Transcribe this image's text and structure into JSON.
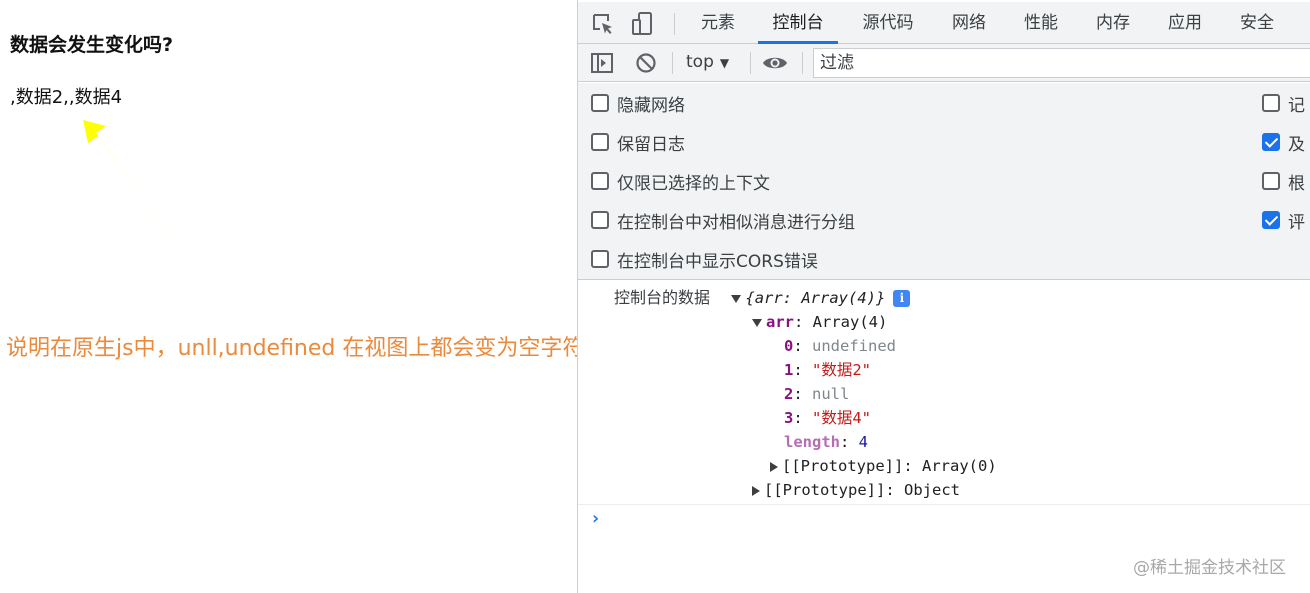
{
  "page": {
    "title": "数据会发生变化吗?",
    "rendered_text": ",数据2,,数据4",
    "annotation": "说明在原生js中，unll,undefined 在视图上都会变为空字符串",
    "annotation_color": "#ea8a3c",
    "arrow_color": "#ffff00"
  },
  "devtools": {
    "tool_icons": [
      "inspect-element-icon",
      "device-toolbar-icon"
    ],
    "tabs": [
      {
        "label": "元素",
        "active": false
      },
      {
        "label": "控制台",
        "active": true
      },
      {
        "label": "源代码",
        "active": false
      },
      {
        "label": "网络",
        "active": false
      },
      {
        "label": "性能",
        "active": false
      },
      {
        "label": "内存",
        "active": false
      },
      {
        "label": "应用",
        "active": false
      },
      {
        "label": "安全",
        "active": false
      }
    ],
    "accent_color": "#1a73e8",
    "toolbar": {
      "context": "top",
      "filter_placeholder": "过滤"
    },
    "settings_left": [
      {
        "label": "隐藏网络",
        "checked": false
      },
      {
        "label": "保留日志",
        "checked": false
      },
      {
        "label": "仅限已选择的上下文",
        "checked": false
      },
      {
        "label": "在控制台中对相似消息进行分组",
        "checked": false
      },
      {
        "label": "在控制台中显示CORS错误",
        "checked": false
      }
    ],
    "settings_right": [
      {
        "label": "记",
        "checked": false
      },
      {
        "label": "及",
        "checked": true
      },
      {
        "label": "根",
        "checked": false
      },
      {
        "label": "评",
        "checked": true
      }
    ],
    "console": {
      "label": "控制台的数据",
      "summary": "{arr: Array(4)}",
      "info_badge": "i",
      "arr_key": "arr",
      "arr_value": "Array(4)",
      "items": [
        {
          "key": "0",
          "value": "undefined",
          "kind": "gray"
        },
        {
          "key": "1",
          "value": "\"数据2\"",
          "kind": "str"
        },
        {
          "key": "2",
          "value": "null",
          "kind": "gray"
        },
        {
          "key": "3",
          "value": "\"数据4\"",
          "kind": "str"
        }
      ],
      "length_key": "length",
      "length_value": "4",
      "arr_proto_key": "[[Prototype]]",
      "arr_proto_value": "Array(0)",
      "obj_proto_key": "[[Prototype]]",
      "obj_proto_value": "Object",
      "prompt": "›"
    },
    "watermark": "@稀土掘金技术社区"
  }
}
